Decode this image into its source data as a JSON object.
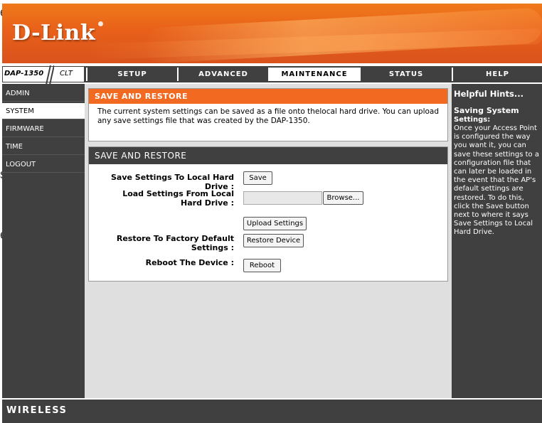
{
  "stray_text": {
    "t1": "es",
    "t2": "s",
    "t3": "ent"
  },
  "header": {
    "logo": "D-Link"
  },
  "model": {
    "name": "DAP-1350",
    "variant": "CLT"
  },
  "tabs": [
    {
      "label": "SETUP",
      "active": false
    },
    {
      "label": "ADVANCED",
      "active": false
    },
    {
      "label": "MAINTENANCE",
      "active": true
    },
    {
      "label": "STATUS",
      "active": false
    },
    {
      "label": "HELP",
      "active": false
    }
  ],
  "sidebar": {
    "items": [
      {
        "label": "ADMIN",
        "active": false
      },
      {
        "label": "SYSTEM",
        "active": true
      },
      {
        "label": "FIRMWARE",
        "active": false
      },
      {
        "label": "TIME",
        "active": false
      },
      {
        "label": "LOGOUT",
        "active": false
      }
    ]
  },
  "intro": {
    "title": "SAVE AND RESTORE",
    "text": "The current system settings can be saved as a file onto thelocal hard drive. You can upload any save settings file that was created by the DAP-1350."
  },
  "panel": {
    "title": "SAVE AND RESTORE",
    "save_label": "Save Settings To Local Hard Drive :",
    "save_button": "Save",
    "load_label": "Load Settings From Local Hard Drive :",
    "file_value": "",
    "browse_button": "Browse...",
    "upload_button": "Upload Settings",
    "restore_label": "Restore To Factory Default Settings :",
    "restore_button": "Restore Device",
    "reboot_label": "Reboot The Device :",
    "reboot_button": "Reboot"
  },
  "help": {
    "title": "Helpful Hints...",
    "subtitle": "Saving System",
    "subtitle2": "Settings:",
    "body": "Once your Access Point is configured the way you want it, you can save these settings to a configuration file that can later be loaded in the event that the AP's default settings are restored. To do this, click the Save button next to where it says Save Settings to Local Hard Drive."
  },
  "footer": {
    "brand": "WIRELESS"
  },
  "colors": {
    "orange": "#f26a21",
    "dark": "#404040",
    "panel_bg": "#dfdfdf"
  }
}
